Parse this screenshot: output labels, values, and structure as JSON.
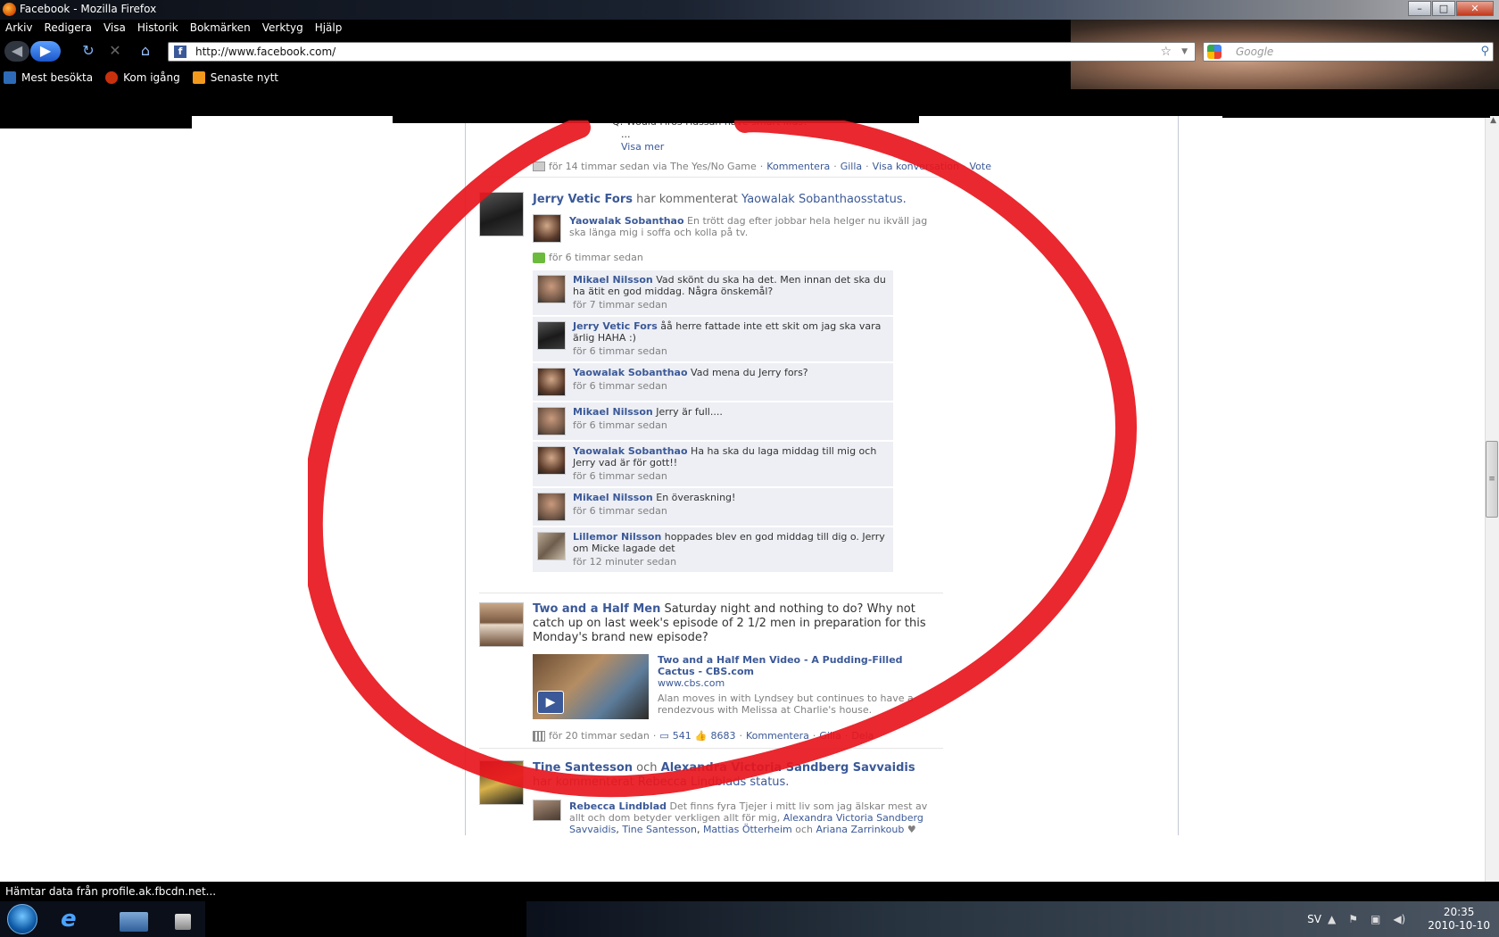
{
  "window": {
    "title": "Facebook - Mozilla Firefox"
  },
  "menu": [
    "Arkiv",
    "Redigera",
    "Visa",
    "Historik",
    "Bokmärken",
    "Verktyg",
    "Hjälp"
  ],
  "nav": {
    "url": "http://www.facebook.com/",
    "search_placeholder": "Google"
  },
  "bookmarks": [
    "Mest besökta",
    "Kom igång",
    "Senaste nytt"
  ],
  "feed": {
    "top_story": {
      "partial_text": "Q: Would Firos Hassan have smart kids?",
      "ellipsis": "...",
      "see_more": "Visa mer",
      "meta": "för 14 timmar sedan via The Yes/No Game",
      "actions": [
        "Kommentera",
        "Gilla",
        "Visa konversation",
        "Vote"
      ]
    },
    "story2": {
      "actor": "Jerry Vetic Fors",
      "verb": "har kommenterat",
      "target": "Yaowalak Sobanthaos",
      "target_suffix": "status.",
      "status_author": "Yaowalak Sobanthao",
      "status_text": "En trött dag efter jobbar hela helger nu ikväll jag ska länga mig i soffa och kolla på tv.",
      "time": "för 6 timmar sedan",
      "comments": [
        {
          "name": "Mikael Nilsson",
          "text": "Vad skönt du ska ha det. Men innan det ska du ha ätit en god middag. Några önskemål?",
          "time": "för 7 timmar sedan"
        },
        {
          "name": "Jerry Vetic Fors",
          "text": "åå herre fattade inte ett skit om jag ska vara ärlig HAHA :)",
          "time": "för 6 timmar sedan"
        },
        {
          "name": "Yaowalak Sobanthao",
          "text": "Vad mena du Jerry fors?",
          "time": "för 6 timmar sedan"
        },
        {
          "name": "Mikael Nilsson",
          "text": "Jerry är full....",
          "time": "för 6 timmar sedan"
        },
        {
          "name": "Yaowalak Sobanthao",
          "text": "Ha ha ska du laga middag till mig och Jerry vad är för gott!!",
          "time": "för 6 timmar sedan"
        },
        {
          "name": "Mikael Nilsson",
          "text": "En överaskning!",
          "time": "för 6 timmar sedan"
        },
        {
          "name": "Lillemor Nilsson",
          "text": "hoppades blev en god middag till dig o. Jerry om Micke lagade det",
          "time": "för 12 minuter sedan"
        }
      ]
    },
    "story3": {
      "actor": "Two and a Half Men",
      "text": "Saturday night and nothing to do? Why not catch up on last week's episode of 2 1/2 men in preparation for this Monday's brand new episode?",
      "link_title": "Two and a Half Men Video - A Pudding-Filled Cactus - CBS.com",
      "link_domain": "www.cbs.com",
      "link_desc": "Alan moves in with Lyndsey but continues to have a rendezvous with Melissa at Charlie's house.",
      "time": "för 20 timmar sedan",
      "comment_count": "541",
      "like_count": "8683",
      "actions": [
        "Kommentera",
        "Gilla",
        "Dela"
      ]
    },
    "story4": {
      "actor1": "Tine Santesson",
      "and": "och",
      "actor2": "Alexandra Victoria Sandberg Savvaidis",
      "verb": "har kommenterat",
      "target": "Rebecca Lindblads",
      "target_suffix": "status.",
      "status_author": "Rebecca Lindblad",
      "status_text": "Det finns fyra Tjejer i mitt liv som jag älskar mest av allt och dom betyder verkligen allt för mig,",
      "tag1": "Alexandra Victoria Sandberg Savvaidis",
      "tag2": "Tine Santesson",
      "tag3": "Mattias Ötterheim",
      "and2": "och",
      "tag4": "Ariana Zarrinkoub",
      "heart": "♥"
    }
  },
  "status_bar": "Hämtar data från profile.ak.fbcdn.net...",
  "taskbar": {
    "lang": "SV",
    "time": "20:35",
    "date": "2010-10-10"
  },
  "colors": {
    "fb_link": "#3b5998",
    "annotation_red": "#e8161d"
  }
}
